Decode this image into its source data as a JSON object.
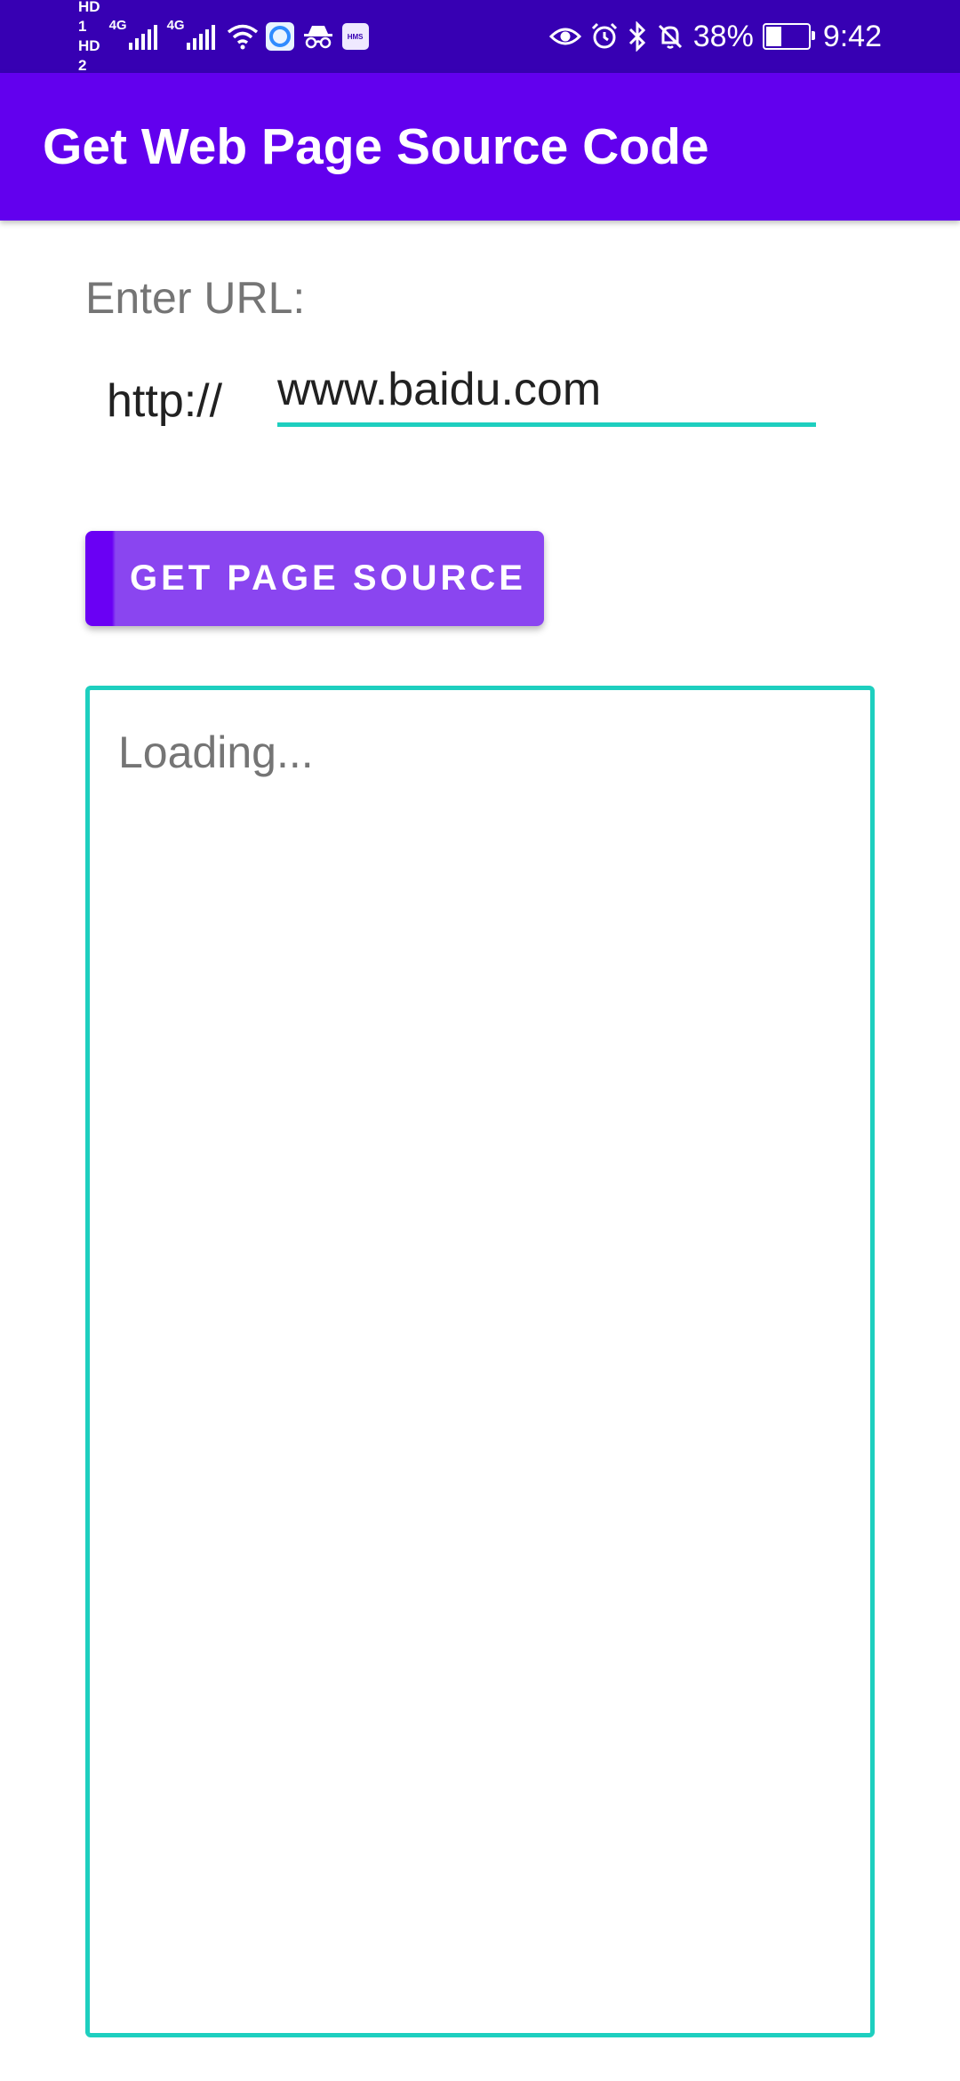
{
  "status_bar": {
    "sim1": "HD",
    "sim1_index": "1",
    "sim2": "HD",
    "sim2_index": "2",
    "network1": "4G",
    "network2": "4G",
    "hms_badge": "HMS",
    "battery_percent": "38%",
    "battery_level": 0.38,
    "time": "9:42",
    "icons": [
      "signal-icon",
      "wifi-icon",
      "app-badge-icon",
      "incognito-icon",
      "hms-icon",
      "eye-icon",
      "alarm-icon",
      "bluetooth-icon",
      "mute-icon",
      "battery-charging-icon"
    ]
  },
  "app_bar": {
    "title": "Get Web Page Source Code",
    "color": "#6200ee"
  },
  "form": {
    "enter_label": "Enter URL:",
    "protocol": "http://",
    "url_value": "www.baidu.com",
    "button_label": "GET PAGE SOURCE"
  },
  "output": {
    "text": "Loading..."
  },
  "colors": {
    "status_bar": "#3700b3",
    "primary": "#6200ee",
    "accent": "#1ecfbf",
    "button": "#8a45f0"
  }
}
